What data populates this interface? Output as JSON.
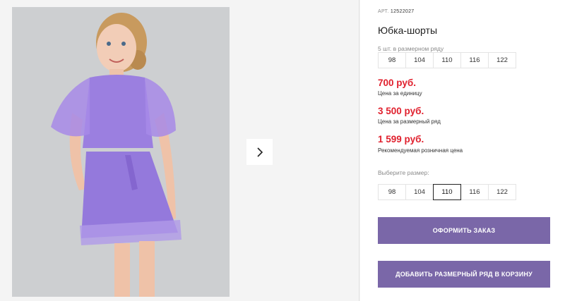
{
  "product": {
    "article_label": "АРТ.",
    "article_number": "12522027",
    "title": "Юбка-шорты",
    "range_caption": "5 шт. в размерном ряду",
    "range_sizes": [
      "98",
      "104",
      "110",
      "116",
      "122"
    ]
  },
  "prices": [
    {
      "value": "700 руб.",
      "caption": "Цена за единицу"
    },
    {
      "value": "3 500 руб.",
      "caption": "Цена за размерный ряд"
    },
    {
      "value": "1 599 руб.",
      "caption": "Рекомендуемая розничная цена"
    }
  ],
  "size_picker": {
    "caption": "Выберите размер:",
    "options": [
      "98",
      "104",
      "110",
      "116",
      "122"
    ],
    "selected": "110"
  },
  "actions": {
    "order_label": "ОФОРМИТЬ ЗАКАЗ",
    "add_range_label": "ДОБАВИТЬ РАЗМЕРНЫЙ РЯД В КОРЗИНУ"
  },
  "gallery": {
    "next_icon": "chevron-right-icon"
  },
  "colors": {
    "accent_button": "#7a67a8",
    "price": "#e0212e",
    "outfit": "#9d7fe0"
  }
}
